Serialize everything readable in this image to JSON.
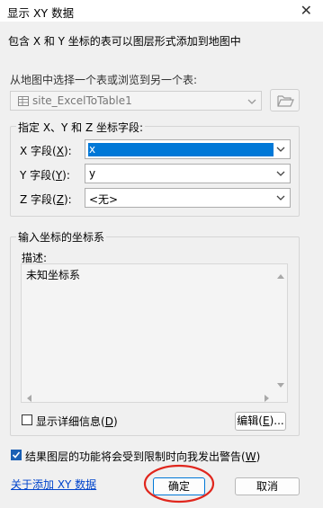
{
  "window": {
    "title": "显示 XY 数据",
    "close_glyph": "✕"
  },
  "intro_text": "包含 X 和 Y 坐标的表可以图层形式添加到地图中",
  "source": {
    "label": "从地图中选择一个表或浏览到另一个表:",
    "table_value": "site_ExcelToTable1"
  },
  "fields_group": {
    "legend": "指定 X、Y 和 Z 坐标字段:",
    "x": {
      "label_prefix": "X 字段(",
      "hotkey": "X",
      "label_suffix": "):",
      "value": "x"
    },
    "y": {
      "label_prefix": "Y 字段(",
      "hotkey": "Y",
      "label_suffix": "):",
      "value": "y"
    },
    "z": {
      "label_prefix": "Z 字段(",
      "hotkey": "Z",
      "label_suffix": "):",
      "value": "<无>"
    }
  },
  "coord_group": {
    "legend": "输入坐标的坐标系",
    "desc_label": "描述:",
    "desc_text": "未知坐标系",
    "show_details": {
      "prefix": "显示详细信息(",
      "hotkey": "D",
      "suffix": ")",
      "checked": false
    },
    "edit_button": {
      "prefix": "编辑(",
      "hotkey": "E",
      "suffix": ")..."
    }
  },
  "warn": {
    "prefix": "结果图层的功能将会受到限制时向我发出警告(",
    "hotkey": "W",
    "suffix": ")",
    "checked": true
  },
  "about_link": "关于添加 XY 数据",
  "ok_label": "确定",
  "cancel_label": "取消",
  "colors": {
    "accent": "#0078d7",
    "annotation_circle": "#e0261d"
  }
}
